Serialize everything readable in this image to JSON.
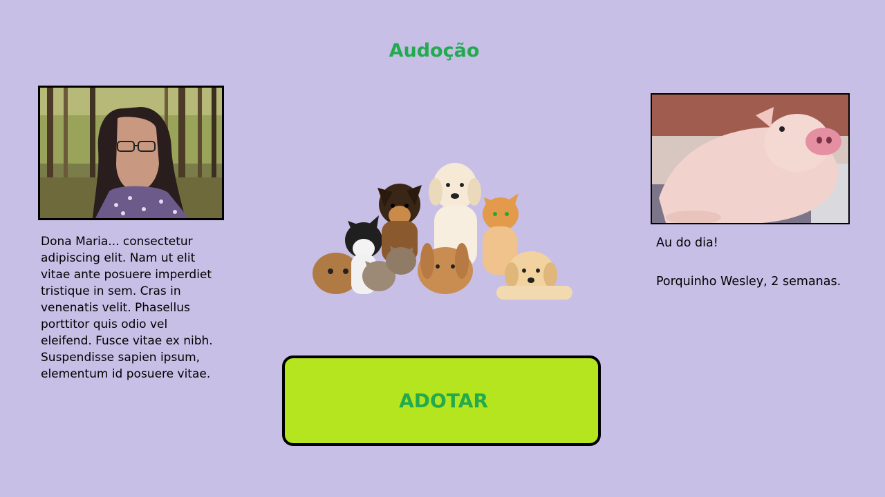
{
  "header": {
    "title": "Audoção"
  },
  "colors": {
    "background": "#c7bfe6",
    "accent_green": "#22aa4e",
    "button_fill": "#b4e51f"
  },
  "left_panel": {
    "photo": "woman-portrait-photo",
    "description": "Dona Maria... consectetur adipiscing elit. Nam ut elit vitae ante posuere imperdiet tristique in sem. Cras in venenatis velit. Phasellus porttitor quis odio vel eleifend. Fusce vitae ex nibh. Suspendisse sapien ipsum, elementum id posuere vitae."
  },
  "center_panel": {
    "image": "pets-group-photo",
    "adopt_label": "ADOTAR"
  },
  "right_panel": {
    "photo": "piglet-photo",
    "headline": "Au do dia!",
    "caption": "Porquinho Wesley, 2 semanas."
  }
}
